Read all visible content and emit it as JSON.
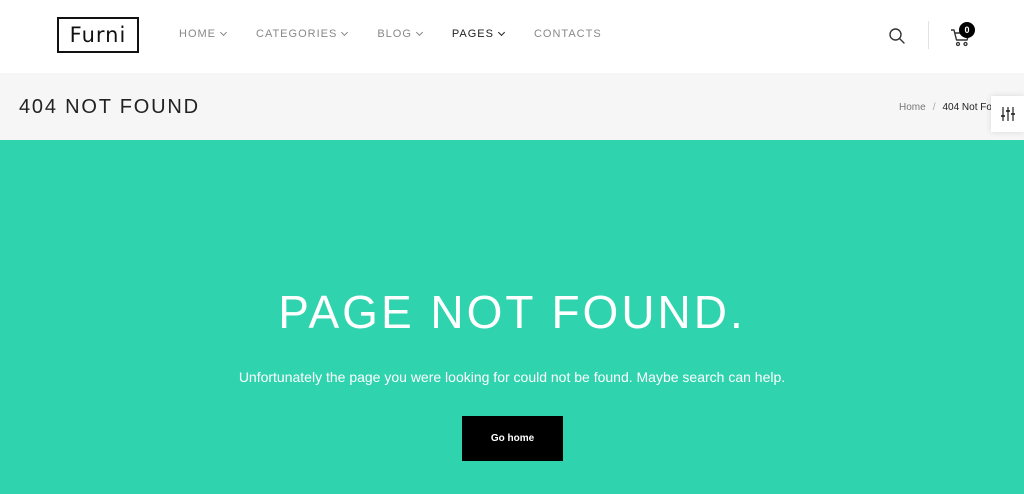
{
  "header": {
    "logo": "Furni",
    "nav": [
      {
        "label": "HOME",
        "has_dropdown": true,
        "active": false
      },
      {
        "label": "CATEGORIES",
        "has_dropdown": true,
        "active": false
      },
      {
        "label": "BLOG",
        "has_dropdown": true,
        "active": false
      },
      {
        "label": "PAGES",
        "has_dropdown": true,
        "active": true
      },
      {
        "label": "CONTACTS",
        "has_dropdown": false,
        "active": false
      }
    ],
    "cart_count": "0",
    "icons": {
      "search": "search-icon",
      "cart": "cart-icon",
      "filter": "sliders-icon"
    }
  },
  "breadcrumb_bar": {
    "title": "404 NOT FOUND",
    "crumbs": {
      "home": "Home",
      "separator": "/",
      "current": "404 Not Fo"
    }
  },
  "hero": {
    "title": "PAGE NOT FOUND.",
    "message": "Unfortunately the page you were looking for could not be found. Maybe search can help.",
    "button_label": "Go home"
  },
  "colors": {
    "accent": "#2fd3ae",
    "button": "#000000",
    "crumb_bar": "#f6f6f6"
  }
}
